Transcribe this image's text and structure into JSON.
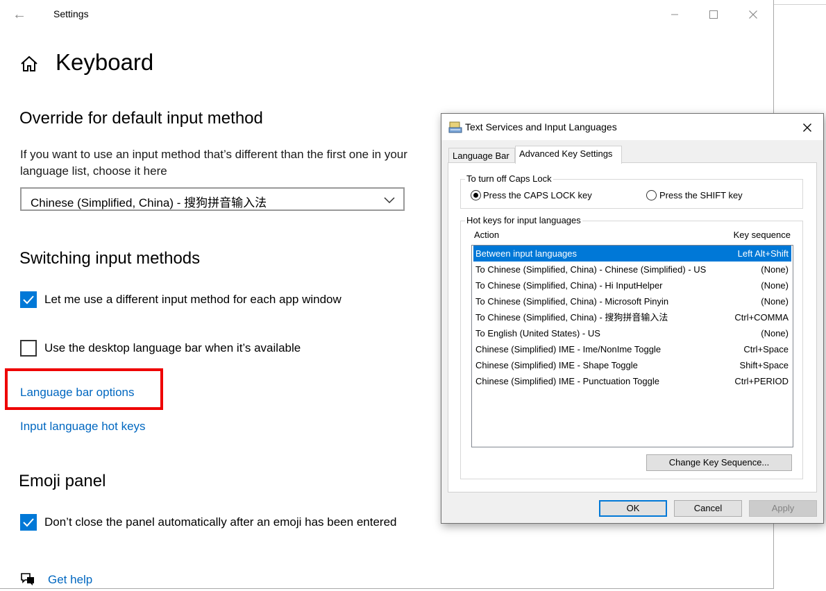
{
  "window": {
    "title": "Settings"
  },
  "page": {
    "title": "Keyboard"
  },
  "override": {
    "heading": "Override for default input method",
    "description": "If you want to use an input method that’s different than the first one in your language list, choose it here",
    "selected": "Chinese (Simplified, China) - 搜狗拼音输入法"
  },
  "switching": {
    "heading": "Switching input methods",
    "checkbox1": {
      "label": "Let me use a different input method for each app window",
      "checked": true
    },
    "checkbox2": {
      "label": "Use the desktop language bar when it’s available",
      "checked": false
    },
    "link_language_bar": "Language bar options",
    "link_hotkeys": "Input language hot keys"
  },
  "emoji": {
    "heading": "Emoji panel",
    "checkbox": {
      "label": "Don’t close the panel automatically after an emoji has been entered",
      "checked": true
    }
  },
  "help": {
    "link": "Get help"
  },
  "dialog": {
    "title": "Text Services and Input Languages",
    "tabs": [
      {
        "label": "Language Bar",
        "active": false
      },
      {
        "label": "Advanced Key Settings",
        "active": true
      }
    ],
    "caps_lock": {
      "group_label": "To turn off Caps Lock",
      "option1": "Press the CAPS LOCK key",
      "option2": "Press the SHIFT key",
      "selected": "option1"
    },
    "hotkeys": {
      "group_label": "Hot keys for input languages",
      "col_action": "Action",
      "col_key": "Key sequence",
      "rows": [
        {
          "action": "Between input languages",
          "key": "Left Alt+Shift",
          "selected": true
        },
        {
          "action": "To Chinese (Simplified, China) - Chinese (Simplified) - US",
          "key": "(None)"
        },
        {
          "action": "To Chinese (Simplified, China) - Hi InputHelper",
          "key": "(None)"
        },
        {
          "action": "To Chinese (Simplified, China) - Microsoft Pinyin",
          "key": "(None)"
        },
        {
          "action": "To Chinese (Simplified, China) - 搜狗拼音输入法",
          "key": "Ctrl+COMMA"
        },
        {
          "action": "To English (United States) - US",
          "key": "(None)"
        },
        {
          "action": "Chinese (Simplified) IME - Ime/NonIme Toggle",
          "key": "Ctrl+Space"
        },
        {
          "action": "Chinese (Simplified) IME - Shape Toggle",
          "key": "Shift+Space"
        },
        {
          "action": "Chinese (Simplified) IME - Punctuation Toggle",
          "key": "Ctrl+PERIOD"
        }
      ],
      "change_button": "Change Key Sequence..."
    },
    "buttons": {
      "ok": "OK",
      "cancel": "Cancel",
      "apply": "Apply"
    }
  },
  "colors": {
    "accent": "#0078d7",
    "link": "#0067c0",
    "highlight_box": "#ee0000"
  },
  "icons": [
    "back-arrow-icon",
    "minimize-icon",
    "maximize-icon",
    "close-icon",
    "home-icon",
    "chevron-down-icon",
    "checkmark-icon",
    "help-icon",
    "keyboard-app-icon"
  ]
}
